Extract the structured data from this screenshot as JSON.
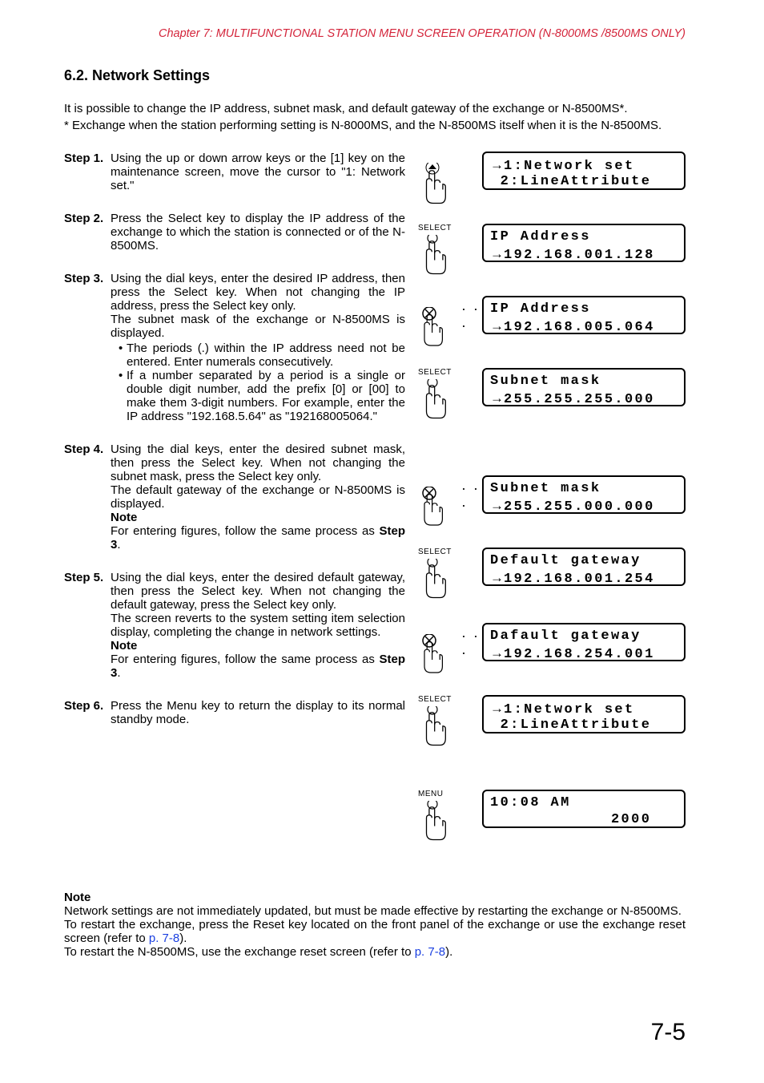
{
  "header": "Chapter 7:  MULTIFUNCTIONAL STATION MENU SCREEN OPERATION (N-8000MS /8500MS ONLY)",
  "section_title": "6.2. Network Settings",
  "intro": {
    "p1": "It is possible to change the IP address, subnet mask, and default gateway of the exchange or N-8500MS*.",
    "p2": "* Exchange when the station performing setting is N-8000MS, and the N-8500MS itself when it is the N-8500MS."
  },
  "steps": {
    "s1": {
      "label": "Step 1.",
      "text": "Using the up or down arrow keys or the [1] key on the maintenance screen, move the cursor to \"1: Network set.\""
    },
    "s2": {
      "label": "Step 2.",
      "text": "Press the Select key to display the IP address of the exchange to which the station is connected or of the N-8500MS."
    },
    "s3": {
      "label": "Step 3.",
      "p1": "Using the dial keys, enter the desired IP address, then press the Select key. When not changing the IP address, press the Select key only.",
      "p2": "The subnet mask of the exchange or N-8500MS is displayed.",
      "b1": "The periods (.) within the IP address need not be entered. Enter numerals consecutively.",
      "b2": "If a number separated by a period is a single or double digit number, add the prefix [0] or [00] to make them 3-digit numbers. For example, enter the IP address \"192.168.5.64\" as \"192168005064.\""
    },
    "s4": {
      "label": "Step 4.",
      "p1": "Using the dial keys, enter the desired subnet mask, then press the Select key. When not changing the subnet mask, press the Select key only.",
      "p2": "The default gateway of the exchange or N-8500MS is displayed.",
      "note_label": "Note",
      "note_pre": "For entering figures, follow the same process as ",
      "note_bold": "Step 3",
      "note_post": "."
    },
    "s5": {
      "label": "Step 5.",
      "p1": "Using the dial keys, enter the desired default gateway, then press the Select key. When not changing the default gateway, press the Select key only.",
      "p2": "The screen reverts to the system setting item selection display, completing the change in network settings.",
      "note_label": "Note",
      "note_pre": "For entering figures, follow the same process as ",
      "note_bold": "Step 3",
      "note_post": "."
    },
    "s6": {
      "label": "Step 6.",
      "text": "Press the Menu key to return the display to its normal standby mode."
    }
  },
  "diagrams": {
    "d1": {
      "label": "",
      "l1": "→1:Network set",
      "l2": " 2:LineAttribute",
      "icon": "updown"
    },
    "d2": {
      "label": "SELECT",
      "l1": "IP Address",
      "l2": "→192.168.001.128",
      "icon": "press"
    },
    "d3": {
      "label": "",
      "l1": "IP Address",
      "l2": "→192.168.005.064",
      "icon": "dial"
    },
    "d4": {
      "label": "SELECT",
      "l1": "Subnet mask",
      "l2": "→255.255.255.000",
      "icon": "press"
    },
    "d5": {
      "label": "",
      "l1": "Subnet mask",
      "l2": "→255.255.000.000",
      "icon": "dial"
    },
    "d6": {
      "label": "SELECT",
      "l1": "Default gateway",
      "l2": "→192.168.001.254",
      "icon": "press"
    },
    "d7": {
      "label": "",
      "l1": "Dafault gateway",
      "l2": "→192.168.254.001",
      "icon": "dial"
    },
    "d8": {
      "label": "SELECT",
      "l1": "→1:Network set",
      "l2": " 2:LineAttribute",
      "icon": "press"
    },
    "d9": {
      "label": "MENU",
      "l1": "10:08 AM",
      "l2": "            2000",
      "icon": "press"
    }
  },
  "bottom_note": {
    "label": "Note",
    "p1": "Network settings are not immediately updated, but must be made effective by restarting the exchange or N-8500MS.",
    "p2a": "To restart the exchange, press the Reset key located on the front panel of the exchange or use the exchange reset screen (refer to ",
    "p2link": "p. 7-8",
    "p2b": ").",
    "p3a": "To restart the N-8500MS, use the exchange reset screen (refer to ",
    "p3link": "p. 7-8",
    "p3b": ")."
  },
  "page_number": "7-5"
}
